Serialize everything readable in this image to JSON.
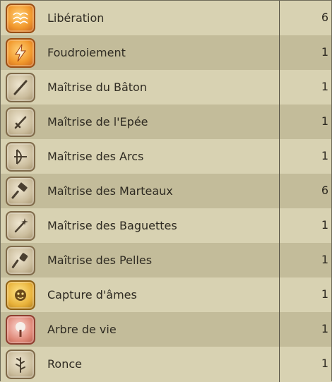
{
  "spells": [
    {
      "name": "Libération",
      "level": "6",
      "icon": "liberation-icon",
      "style": "orange"
    },
    {
      "name": "Foudroiement",
      "level": "1",
      "icon": "lightning-strike-icon",
      "style": "orange"
    },
    {
      "name": "Maîtrise du Bâton",
      "level": "1",
      "icon": "staff-mastery-icon",
      "style": "tan"
    },
    {
      "name": "Maîtrise de l'Epée",
      "level": "1",
      "icon": "sword-mastery-icon",
      "style": "tan"
    },
    {
      "name": "Maîtrise des Arcs",
      "level": "1",
      "icon": "bow-mastery-icon",
      "style": "tan"
    },
    {
      "name": "Maîtrise des Marteaux",
      "level": "6",
      "icon": "hammer-mastery-icon",
      "style": "tan"
    },
    {
      "name": "Maîtrise des Baguettes",
      "level": "1",
      "icon": "wand-mastery-icon",
      "style": "tan"
    },
    {
      "name": "Maîtrise des Pelles",
      "level": "1",
      "icon": "shovel-mastery-icon",
      "style": "tan"
    },
    {
      "name": "Capture d'âmes",
      "level": "1",
      "icon": "soul-capture-icon",
      "style": "gold"
    },
    {
      "name": "Arbre de vie",
      "level": "1",
      "icon": "tree-of-life-icon",
      "style": "pink"
    },
    {
      "name": "Ronce",
      "level": "1",
      "icon": "bramble-icon",
      "style": "tan"
    }
  ],
  "colors": {
    "row_light": "#d8d2b2",
    "row_dark": "#c3bc9a",
    "text": "#2f2b22",
    "separator": "#5a5648"
  }
}
